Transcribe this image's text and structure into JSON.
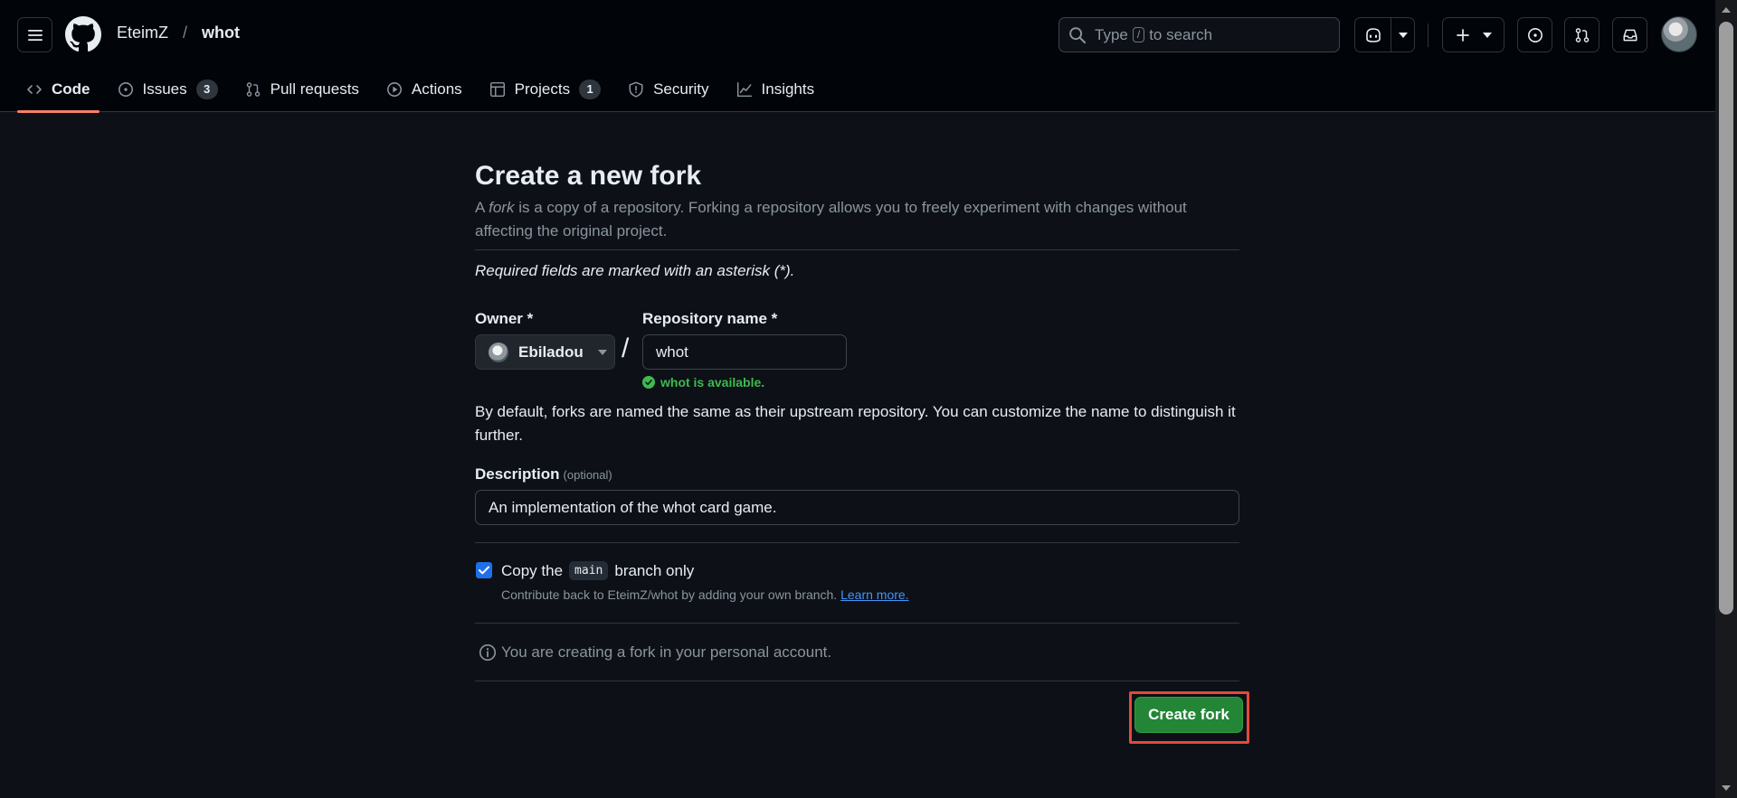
{
  "header": {
    "owner": "EteimZ",
    "separator": "/",
    "repo": "whot",
    "search": {
      "prefix": "Type",
      "key": "/",
      "suffix": "to search"
    }
  },
  "tabs": [
    {
      "label": "Code",
      "icon": "code-icon",
      "active": true
    },
    {
      "label": "Issues",
      "icon": "issue-opened-icon",
      "count": "3"
    },
    {
      "label": "Pull requests",
      "icon": "git-pull-request-icon"
    },
    {
      "label": "Actions",
      "icon": "play-icon"
    },
    {
      "label": "Projects",
      "icon": "table-icon",
      "count": "1"
    },
    {
      "label": "Security",
      "icon": "shield-icon"
    },
    {
      "label": "Insights",
      "icon": "graph-icon"
    }
  ],
  "form": {
    "title": "Create a new fork",
    "subtitle_pre": "A ",
    "subtitle_em": "fork",
    "subtitle_post": " is a copy of a repository. Forking a repository allows you to freely experiment with changes without affecting the original project.",
    "required_note": "Required fields are marked with an asterisk (*).",
    "owner_label": "Owner *",
    "owner_value": "Ebiladou",
    "slash": "/",
    "repo_label": "Repository name *",
    "repo_value": "whot",
    "availability": "whot is available.",
    "naming_hint": "By default, forks are named the same as their upstream repository. You can customize the name to distinguish it further.",
    "description_label": "Description",
    "description_optional": "(optional)",
    "description_value": "An implementation of the whot card game.",
    "copy_pre": "Copy the",
    "copy_branch": "main",
    "copy_post": "branch only",
    "copy_checked": true,
    "contrib_text": "Contribute back to EteimZ/whot by adding your own branch.",
    "learn_more": "Learn more.",
    "info_text": "You are creating a fork in your personal account.",
    "submit_label": "Create fork"
  },
  "colors": {
    "accent_tab": "#f78166",
    "primary_button": "#238636",
    "success": "#3fb950",
    "link": "#4493f8",
    "highlight_outline": "#e5493a"
  }
}
